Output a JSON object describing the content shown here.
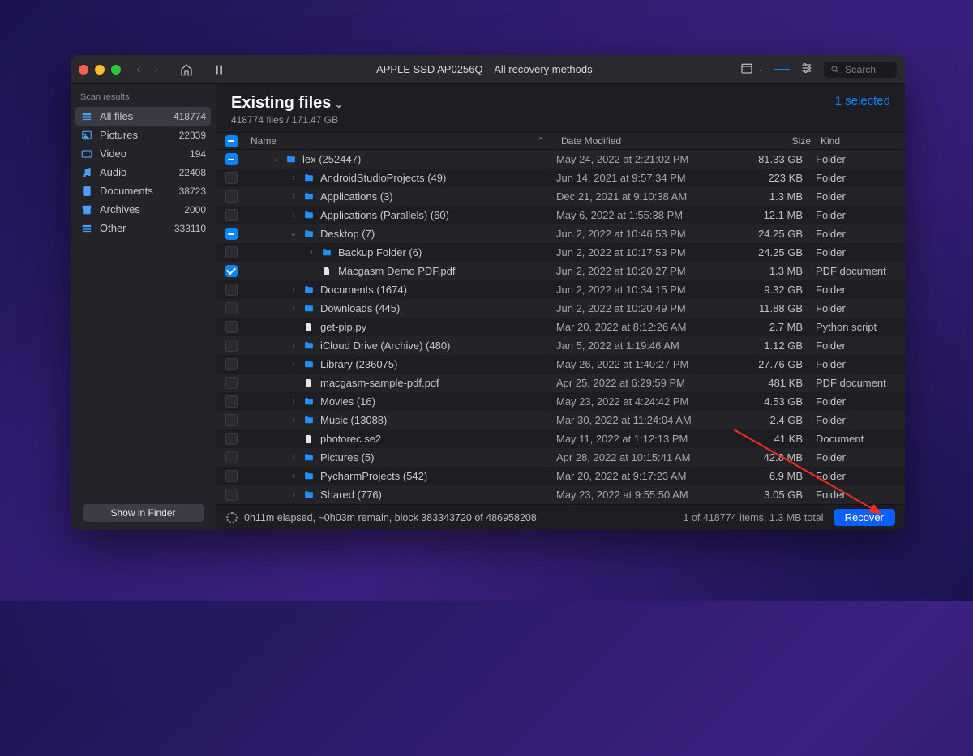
{
  "titlebar": {
    "title": "APPLE SSD AP0256Q – All recovery methods",
    "search_placeholder": "Search"
  },
  "sidebar": {
    "header": "Scan results",
    "items": [
      {
        "label": "All files",
        "count": "418774",
        "icon": "stack"
      },
      {
        "label": "Pictures",
        "count": "22339",
        "icon": "image"
      },
      {
        "label": "Video",
        "count": "194",
        "icon": "video"
      },
      {
        "label": "Audio",
        "count": "22408",
        "icon": "audio"
      },
      {
        "label": "Documents",
        "count": "38723",
        "icon": "doc"
      },
      {
        "label": "Archives",
        "count": "2000",
        "icon": "archive"
      },
      {
        "label": "Other",
        "count": "333110",
        "icon": "stack"
      }
    ],
    "footer_button": "Show in Finder"
  },
  "header": {
    "title": "Existing files",
    "subtitle": "418774 files / 171.47 GB",
    "selected": "1 selected"
  },
  "columns": {
    "name": "Name",
    "date": "Date Modified",
    "size": "Size",
    "kind": "Kind"
  },
  "rows": [
    {
      "chk": "mixed",
      "depth": 1,
      "disc": "down",
      "type": "folder",
      "name": "lex (252447)",
      "date": "May 24, 2022 at 2:21:02 PM",
      "size": "81.33 GB",
      "kind": "Folder"
    },
    {
      "chk": "off",
      "depth": 2,
      "disc": "right",
      "type": "folder",
      "name": "AndroidStudioProjects (49)",
      "date": "Jun 14, 2021 at 9:57:34 PM",
      "size": "223 KB",
      "kind": "Folder"
    },
    {
      "chk": "off",
      "depth": 2,
      "disc": "right",
      "type": "folder",
      "name": "Applications (3)",
      "date": "Dec 21, 2021 at 9:10:38 AM",
      "size": "1.3 MB",
      "kind": "Folder"
    },
    {
      "chk": "off",
      "depth": 2,
      "disc": "right",
      "type": "folder",
      "name": "Applications (Parallels) (60)",
      "date": "May 6, 2022 at 1:55:38 PM",
      "size": "12.1 MB",
      "kind": "Folder"
    },
    {
      "chk": "mixed",
      "depth": 2,
      "disc": "down",
      "type": "folder",
      "name": "Desktop (7)",
      "date": "Jun 2, 2022 at 10:46:53 PM",
      "size": "24.25 GB",
      "kind": "Folder"
    },
    {
      "chk": "off",
      "depth": 3,
      "disc": "right",
      "type": "folder",
      "name": "Backup Folder (6)",
      "date": "Jun 2, 2022 at 10:17:53 PM",
      "size": "24.25 GB",
      "kind": "Folder"
    },
    {
      "chk": "on",
      "depth": 3,
      "disc": "",
      "type": "file",
      "name": "Macgasm Demo PDF.pdf",
      "date": "Jun 2, 2022 at 10:20:27 PM",
      "size": "1.3 MB",
      "kind": "PDF document"
    },
    {
      "chk": "off",
      "depth": 2,
      "disc": "right",
      "type": "folder",
      "name": "Documents (1674)",
      "date": "Jun 2, 2022 at 10:34:15 PM",
      "size": "9.32 GB",
      "kind": "Folder"
    },
    {
      "chk": "off",
      "depth": 2,
      "disc": "right",
      "type": "folder",
      "name": "Downloads (445)",
      "date": "Jun 2, 2022 at 10:20:49 PM",
      "size": "11.88 GB",
      "kind": "Folder"
    },
    {
      "chk": "off",
      "depth": 2,
      "disc": "",
      "type": "file",
      "name": "get-pip.py",
      "date": "Mar 20, 2022 at 8:12:26 AM",
      "size": "2.7 MB",
      "kind": "Python script"
    },
    {
      "chk": "off",
      "depth": 2,
      "disc": "right",
      "type": "folder",
      "name": "iCloud Drive (Archive) (480)",
      "date": "Jan 5, 2022 at 1:19:46 AM",
      "size": "1.12 GB",
      "kind": "Folder"
    },
    {
      "chk": "off",
      "depth": 2,
      "disc": "right",
      "type": "folder",
      "name": "Library (236075)",
      "date": "May 26, 2022 at 1:40:27 PM",
      "size": "27.76 GB",
      "kind": "Folder"
    },
    {
      "chk": "off",
      "depth": 2,
      "disc": "",
      "type": "file",
      "name": "macgasm-sample-pdf.pdf",
      "date": "Apr 25, 2022 at 6:29:59 PM",
      "size": "481 KB",
      "kind": "PDF document"
    },
    {
      "chk": "off",
      "depth": 2,
      "disc": "right",
      "type": "folder",
      "name": "Movies (16)",
      "date": "May 23, 2022 at 4:24:42 PM",
      "size": "4.53 GB",
      "kind": "Folder"
    },
    {
      "chk": "off",
      "depth": 2,
      "disc": "right",
      "type": "folder",
      "name": "Music (13088)",
      "date": "Mar 30, 2022 at 11:24:04 AM",
      "size": "2.4 GB",
      "kind": "Folder"
    },
    {
      "chk": "off",
      "depth": 2,
      "disc": "",
      "type": "file",
      "name": "photorec.se2",
      "date": "May 11, 2022 at 1:12:13 PM",
      "size": "41 KB",
      "kind": "Document"
    },
    {
      "chk": "off",
      "depth": 2,
      "disc": "right",
      "type": "folder",
      "name": "Pictures (5)",
      "date": "Apr 28, 2022 at 10:15:41 AM",
      "size": "42.8 MB",
      "kind": "Folder"
    },
    {
      "chk": "off",
      "depth": 2,
      "disc": "right",
      "type": "folder",
      "name": "PycharmProjects (542)",
      "date": "Mar 20, 2022 at 9:17:23 AM",
      "size": "6.9 MB",
      "kind": "Folder"
    },
    {
      "chk": "off",
      "depth": 2,
      "disc": "right",
      "type": "folder",
      "name": "Shared (776)",
      "date": "May 23, 2022 at 9:55:50 AM",
      "size": "3.05 GB",
      "kind": "Folder"
    }
  ],
  "footer": {
    "progress": "0h11m elapsed, ~0h03m remain, block 383343720 of 486958208",
    "stats": "1 of 418774 items, 1.3 MB total",
    "recover": "Recover"
  }
}
